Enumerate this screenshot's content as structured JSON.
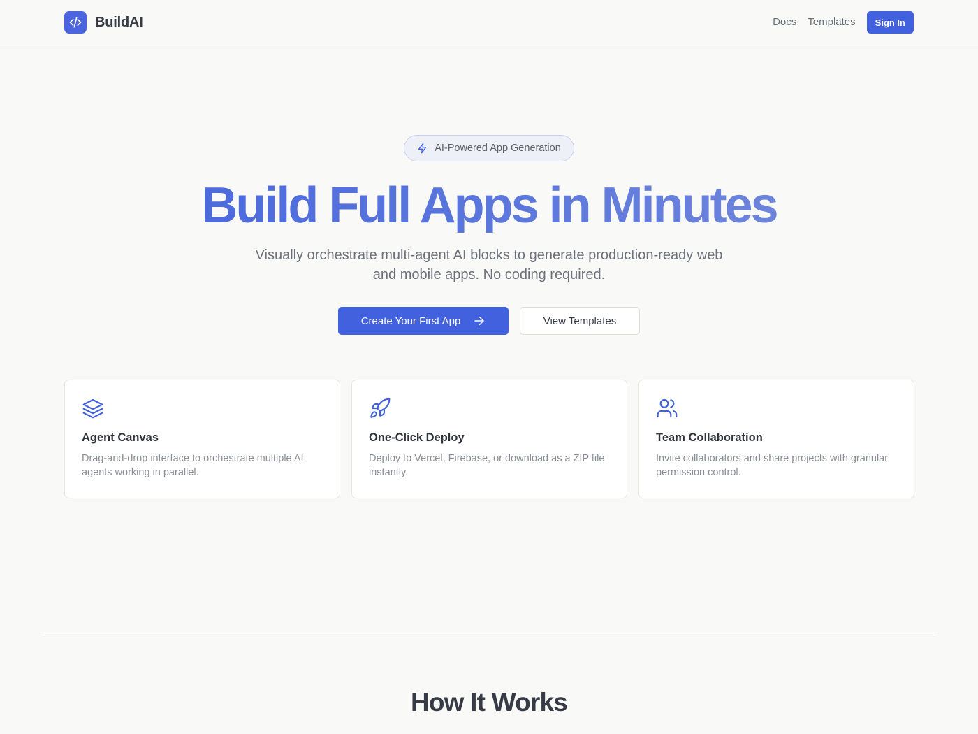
{
  "header": {
    "brand": "BuildAI",
    "nav": {
      "docs": "Docs",
      "templates": "Templates",
      "sign_in": "Sign In"
    }
  },
  "hero": {
    "badge": "AI-Powered App Generation",
    "title": "Build Full Apps in Minutes",
    "subtitle": "Visually orchestrate multi-agent AI blocks to generate production-ready web and mobile apps. No coding required.",
    "primary_cta": "Create Your First App",
    "secondary_cta": "View Templates"
  },
  "features": [
    {
      "icon": "layers-icon",
      "title": "Agent Canvas",
      "desc": "Drag-and-drop interface to orchestrate multiple AI agents working in parallel."
    },
    {
      "icon": "rocket-icon",
      "title": "One-Click Deploy",
      "desc": "Deploy to Vercel, Firebase, or download as a ZIP file instantly."
    },
    {
      "icon": "users-icon",
      "title": "Team Collaboration",
      "desc": "Invite collaborators and share projects with granular permission control."
    }
  ],
  "how_it_works": {
    "title": "How It Works"
  },
  "colors": {
    "accent": "#4261de",
    "background": "#f9f9f7",
    "text": "#363b46",
    "muted": "#8a8d95"
  }
}
